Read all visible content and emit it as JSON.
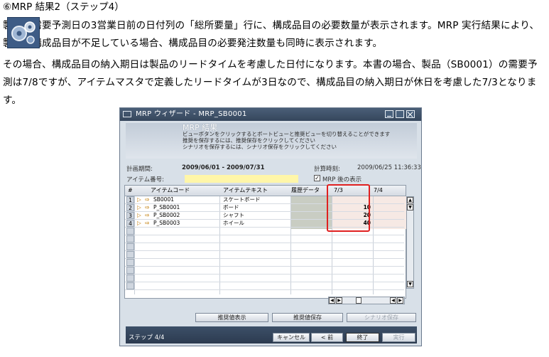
{
  "doc": {
    "heading": "⑥MRP 結果2（ステップ4）",
    "paragraph1": "製品の需要予測日の3営業日前の日付列の「総所要量」行に、構成品目の必要数量が表示されます。MRP 実行結果により、製品の構成品目が不足している場合、構成品目の必要発注数量も同時に表示されます。",
    "paragraph2": "その場合、構成品目の納入期日は製品のリードタイムを考慮した日付になります。本書の場合、製品（SB0001）の需要予測は7/8ですが、アイテムマスタで定義したリードタイムが3日なので、構成品目の納入期日が休日を考慮した7/3となります。"
  },
  "window": {
    "title": "MRP ウィザード - MRP_SB0001",
    "header_title": "MRP 結果",
    "header_lines": [
      "ビューボタンをクリックするとボートビューと推奨ビューを切り替えることができます",
      "推奨を保存するには、推奨保存をクリックしてください",
      "シナリオを保存するには、シナリオ保存をクリックしてください"
    ],
    "period_label": "計画期間:",
    "period_value": "2009/06/01 - 2009/07/31",
    "calc_label": "計算時刻:",
    "calc_value": "2009/06/25 11:36:33",
    "item_no_label": "アイテム番号:",
    "show_after_mrp_label": "MRP 後の表示",
    "show_after_mrp_checked": true
  },
  "grid": {
    "columns": [
      "#",
      "アイテムコード",
      "アイテムテキスト",
      "履歴データ",
      "7/3",
      "7/4"
    ],
    "rows": [
      {
        "no": "1",
        "code": "SB0001",
        "text": "スケートボード",
        "qty": ""
      },
      {
        "no": "2",
        "code": "P_SB0001",
        "text": "ボード",
        "qty": "10"
      },
      {
        "no": "3",
        "code": "P_SB0002",
        "text": "シャフト",
        "qty": "20"
      },
      {
        "no": "4",
        "code": "P_SB0003",
        "text": "ホイール",
        "qty": "40"
      }
    ]
  },
  "buttons": {
    "recommend_view": "推奨値表示",
    "save_recommend": "推奨値保存",
    "save_scenario": "シナリオ保存",
    "cancel": "キャンセル",
    "prev": "< 前",
    "finish": "終了",
    "run": "実行"
  },
  "step_label": "ステップ 4/4"
}
